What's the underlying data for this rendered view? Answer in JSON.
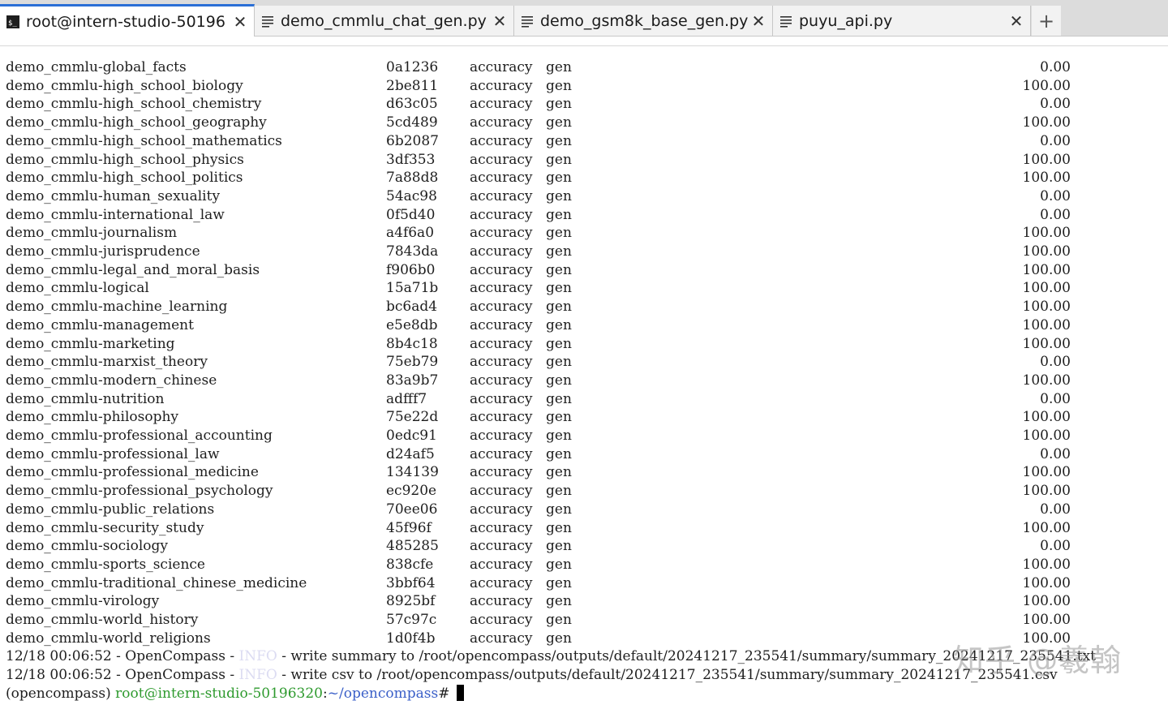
{
  "tabs": [
    {
      "label": "root@intern-studio-50196",
      "icon": "terminal-icon",
      "active": true
    },
    {
      "label": "demo_cmmlu_chat_gen.py",
      "icon": "document-icon",
      "active": false
    },
    {
      "label": "demo_gsm8k_base_gen.py",
      "icon": "document-icon",
      "active": false
    },
    {
      "label": "puyu_api.py",
      "icon": "document-icon",
      "active": false
    }
  ],
  "close_glyph": "✕",
  "new_tab_glyph": "+",
  "rows": [
    {
      "name": "demo_cmmlu-global_facts",
      "version": "0a1236",
      "metric": "accuracy",
      "mode": "gen",
      "score": "0.00"
    },
    {
      "name": "demo_cmmlu-high_school_biology",
      "version": "2be811",
      "metric": "accuracy",
      "mode": "gen",
      "score": "100.00"
    },
    {
      "name": "demo_cmmlu-high_school_chemistry",
      "version": "d63c05",
      "metric": "accuracy",
      "mode": "gen",
      "score": "0.00"
    },
    {
      "name": "demo_cmmlu-high_school_geography",
      "version": "5cd489",
      "metric": "accuracy",
      "mode": "gen",
      "score": "100.00"
    },
    {
      "name": "demo_cmmlu-high_school_mathematics",
      "version": "6b2087",
      "metric": "accuracy",
      "mode": "gen",
      "score": "0.00"
    },
    {
      "name": "demo_cmmlu-high_school_physics",
      "version": "3df353",
      "metric": "accuracy",
      "mode": "gen",
      "score": "100.00"
    },
    {
      "name": "demo_cmmlu-high_school_politics",
      "version": "7a88d8",
      "metric": "accuracy",
      "mode": "gen",
      "score": "100.00"
    },
    {
      "name": "demo_cmmlu-human_sexuality",
      "version": "54ac98",
      "metric": "accuracy",
      "mode": "gen",
      "score": "0.00"
    },
    {
      "name": "demo_cmmlu-international_law",
      "version": "0f5d40",
      "metric": "accuracy",
      "mode": "gen",
      "score": "0.00"
    },
    {
      "name": "demo_cmmlu-journalism",
      "version": "a4f6a0",
      "metric": "accuracy",
      "mode": "gen",
      "score": "100.00"
    },
    {
      "name": "demo_cmmlu-jurisprudence",
      "version": "7843da",
      "metric": "accuracy",
      "mode": "gen",
      "score": "100.00"
    },
    {
      "name": "demo_cmmlu-legal_and_moral_basis",
      "version": "f906b0",
      "metric": "accuracy",
      "mode": "gen",
      "score": "100.00"
    },
    {
      "name": "demo_cmmlu-logical",
      "version": "15a71b",
      "metric": "accuracy",
      "mode": "gen",
      "score": "100.00"
    },
    {
      "name": "demo_cmmlu-machine_learning",
      "version": "bc6ad4",
      "metric": "accuracy",
      "mode": "gen",
      "score": "100.00"
    },
    {
      "name": "demo_cmmlu-management",
      "version": "e5e8db",
      "metric": "accuracy",
      "mode": "gen",
      "score": "100.00"
    },
    {
      "name": "demo_cmmlu-marketing",
      "version": "8b4c18",
      "metric": "accuracy",
      "mode": "gen",
      "score": "100.00"
    },
    {
      "name": "demo_cmmlu-marxist_theory",
      "version": "75eb79",
      "metric": "accuracy",
      "mode": "gen",
      "score": "0.00"
    },
    {
      "name": "demo_cmmlu-modern_chinese",
      "version": "83a9b7",
      "metric": "accuracy",
      "mode": "gen",
      "score": "100.00"
    },
    {
      "name": "demo_cmmlu-nutrition",
      "version": "adfff7",
      "metric": "accuracy",
      "mode": "gen",
      "score": "0.00"
    },
    {
      "name": "demo_cmmlu-philosophy",
      "version": "75e22d",
      "metric": "accuracy",
      "mode": "gen",
      "score": "100.00"
    },
    {
      "name": "demo_cmmlu-professional_accounting",
      "version": "0edc91",
      "metric": "accuracy",
      "mode": "gen",
      "score": "100.00"
    },
    {
      "name": "demo_cmmlu-professional_law",
      "version": "d24af5",
      "metric": "accuracy",
      "mode": "gen",
      "score": "0.00"
    },
    {
      "name": "demo_cmmlu-professional_medicine",
      "version": "134139",
      "metric": "accuracy",
      "mode": "gen",
      "score": "100.00"
    },
    {
      "name": "demo_cmmlu-professional_psychology",
      "version": "ec920e",
      "metric": "accuracy",
      "mode": "gen",
      "score": "100.00"
    },
    {
      "name": "demo_cmmlu-public_relations",
      "version": "70ee06",
      "metric": "accuracy",
      "mode": "gen",
      "score": "0.00"
    },
    {
      "name": "demo_cmmlu-security_study",
      "version": "45f96f",
      "metric": "accuracy",
      "mode": "gen",
      "score": "100.00"
    },
    {
      "name": "demo_cmmlu-sociology",
      "version": "485285",
      "metric": "accuracy",
      "mode": "gen",
      "score": "0.00"
    },
    {
      "name": "demo_cmmlu-sports_science",
      "version": "838cfe",
      "metric": "accuracy",
      "mode": "gen",
      "score": "100.00"
    },
    {
      "name": "demo_cmmlu-traditional_chinese_medicine",
      "version": "3bbf64",
      "metric": "accuracy",
      "mode": "gen",
      "score": "100.00"
    },
    {
      "name": "demo_cmmlu-virology",
      "version": "8925bf",
      "metric": "accuracy",
      "mode": "gen",
      "score": "100.00"
    },
    {
      "name": "demo_cmmlu-world_history",
      "version": "57c97c",
      "metric": "accuracy",
      "mode": "gen",
      "score": "100.00"
    },
    {
      "name": "demo_cmmlu-world_religions",
      "version": "1d0f4b",
      "metric": "accuracy",
      "mode": "gen",
      "score": "100.00"
    }
  ],
  "log_lines": [
    {
      "prefix": "12/18 00:06:52 - OpenCompass - ",
      "level": "INFO",
      "message": " - write summary to /root/opencompass/outputs/default/20241217_235541/summary/summary_20241217_235541.txt"
    },
    {
      "prefix": "12/18 00:06:52 - OpenCompass - ",
      "level": "INFO",
      "message": " - write csv to /root/opencompass/outputs/default/20241217_235541/summary/summary_20241217_235541.csv"
    }
  ],
  "prompt": {
    "env": "(opencompass) ",
    "user_host": "root@intern-studio-50196320",
    "colon": ":",
    "path": "~/opencompass",
    "symbol": "# "
  },
  "watermark": "知乎 @羲翰",
  "colors": {
    "active_tab_accent": "#2b6fd6",
    "prompt_user": "#2e9a2e",
    "prompt_path": "#3a5fc8",
    "info_level": "#dcdcf2"
  }
}
